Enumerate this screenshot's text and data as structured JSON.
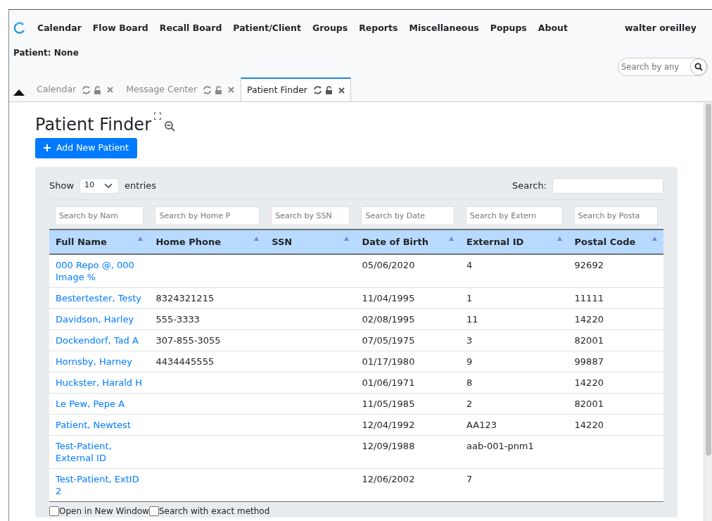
{
  "nav": {
    "menu": [
      "Calendar",
      "Flow Board",
      "Recall Board",
      "Patient/Client",
      "Groups",
      "Reports",
      "Miscellaneous",
      "Popups",
      "About"
    ],
    "user": "walter oreilley"
  },
  "patient_label": "Patient: None",
  "header_search": {
    "placeholder": "Search by any"
  },
  "tabs": [
    {
      "label": "Calendar",
      "selected": false
    },
    {
      "label": "Message Center",
      "selected": false
    },
    {
      "label": "Patient Finder",
      "selected": true
    }
  ],
  "page_title": "Patient Finder",
  "add_button": "Add New Patient",
  "length_control": {
    "before": "Show",
    "value": "10",
    "after": "entries"
  },
  "search_label": "Search:",
  "column_filters": [
    {
      "placeholder": "Search by Nam"
    },
    {
      "placeholder": "Search by Home P"
    },
    {
      "placeholder": "Search by SSN"
    },
    {
      "placeholder": "Search by Date"
    },
    {
      "placeholder": "Search by Extern"
    },
    {
      "placeholder": "Search by Posta"
    }
  ],
  "table": {
    "columns": [
      "Full Name",
      "Home Phone",
      "SSN",
      "Date of Birth",
      "External ID",
      "Postal Code"
    ],
    "rows": [
      [
        "000 Repo @, 000 Image %",
        "",
        "",
        "05/06/2020",
        "4",
        "92692"
      ],
      [
        "Bestertester, Testy",
        "8324321215",
        "",
        "11/04/1995",
        "1",
        "11111"
      ],
      [
        "Davidson, Harley",
        "555-3333",
        "",
        "02/08/1995",
        "11",
        "14220"
      ],
      [
        "Dockendorf, Tad A",
        "307-855-3055",
        "",
        "07/05/1975",
        "3",
        "82001"
      ],
      [
        "Hornsby, Harney",
        "4434445555",
        "",
        "01/17/1980",
        "9",
        "99887"
      ],
      [
        "Huckster, Harald H",
        "",
        "",
        "01/06/1971",
        "8",
        "14220"
      ],
      [
        "Le Pew, Pepe A",
        "",
        "",
        "11/05/1985",
        "2",
        "82001"
      ],
      [
        "Patient, Newtest",
        "",
        "",
        "12/04/1992",
        "AA123",
        "14220"
      ],
      [
        "Test-Patient, External ID",
        "",
        "",
        "12/09/1988",
        "aab-001-pnm1",
        ""
      ],
      [
        "Test-Patient, ExtID 2",
        "",
        "",
        "12/06/2002",
        "7",
        ""
      ]
    ]
  },
  "options": [
    {
      "label": "Open in New Window",
      "checked": false
    },
    {
      "label": "Search with exact method",
      "checked": false
    }
  ]
}
